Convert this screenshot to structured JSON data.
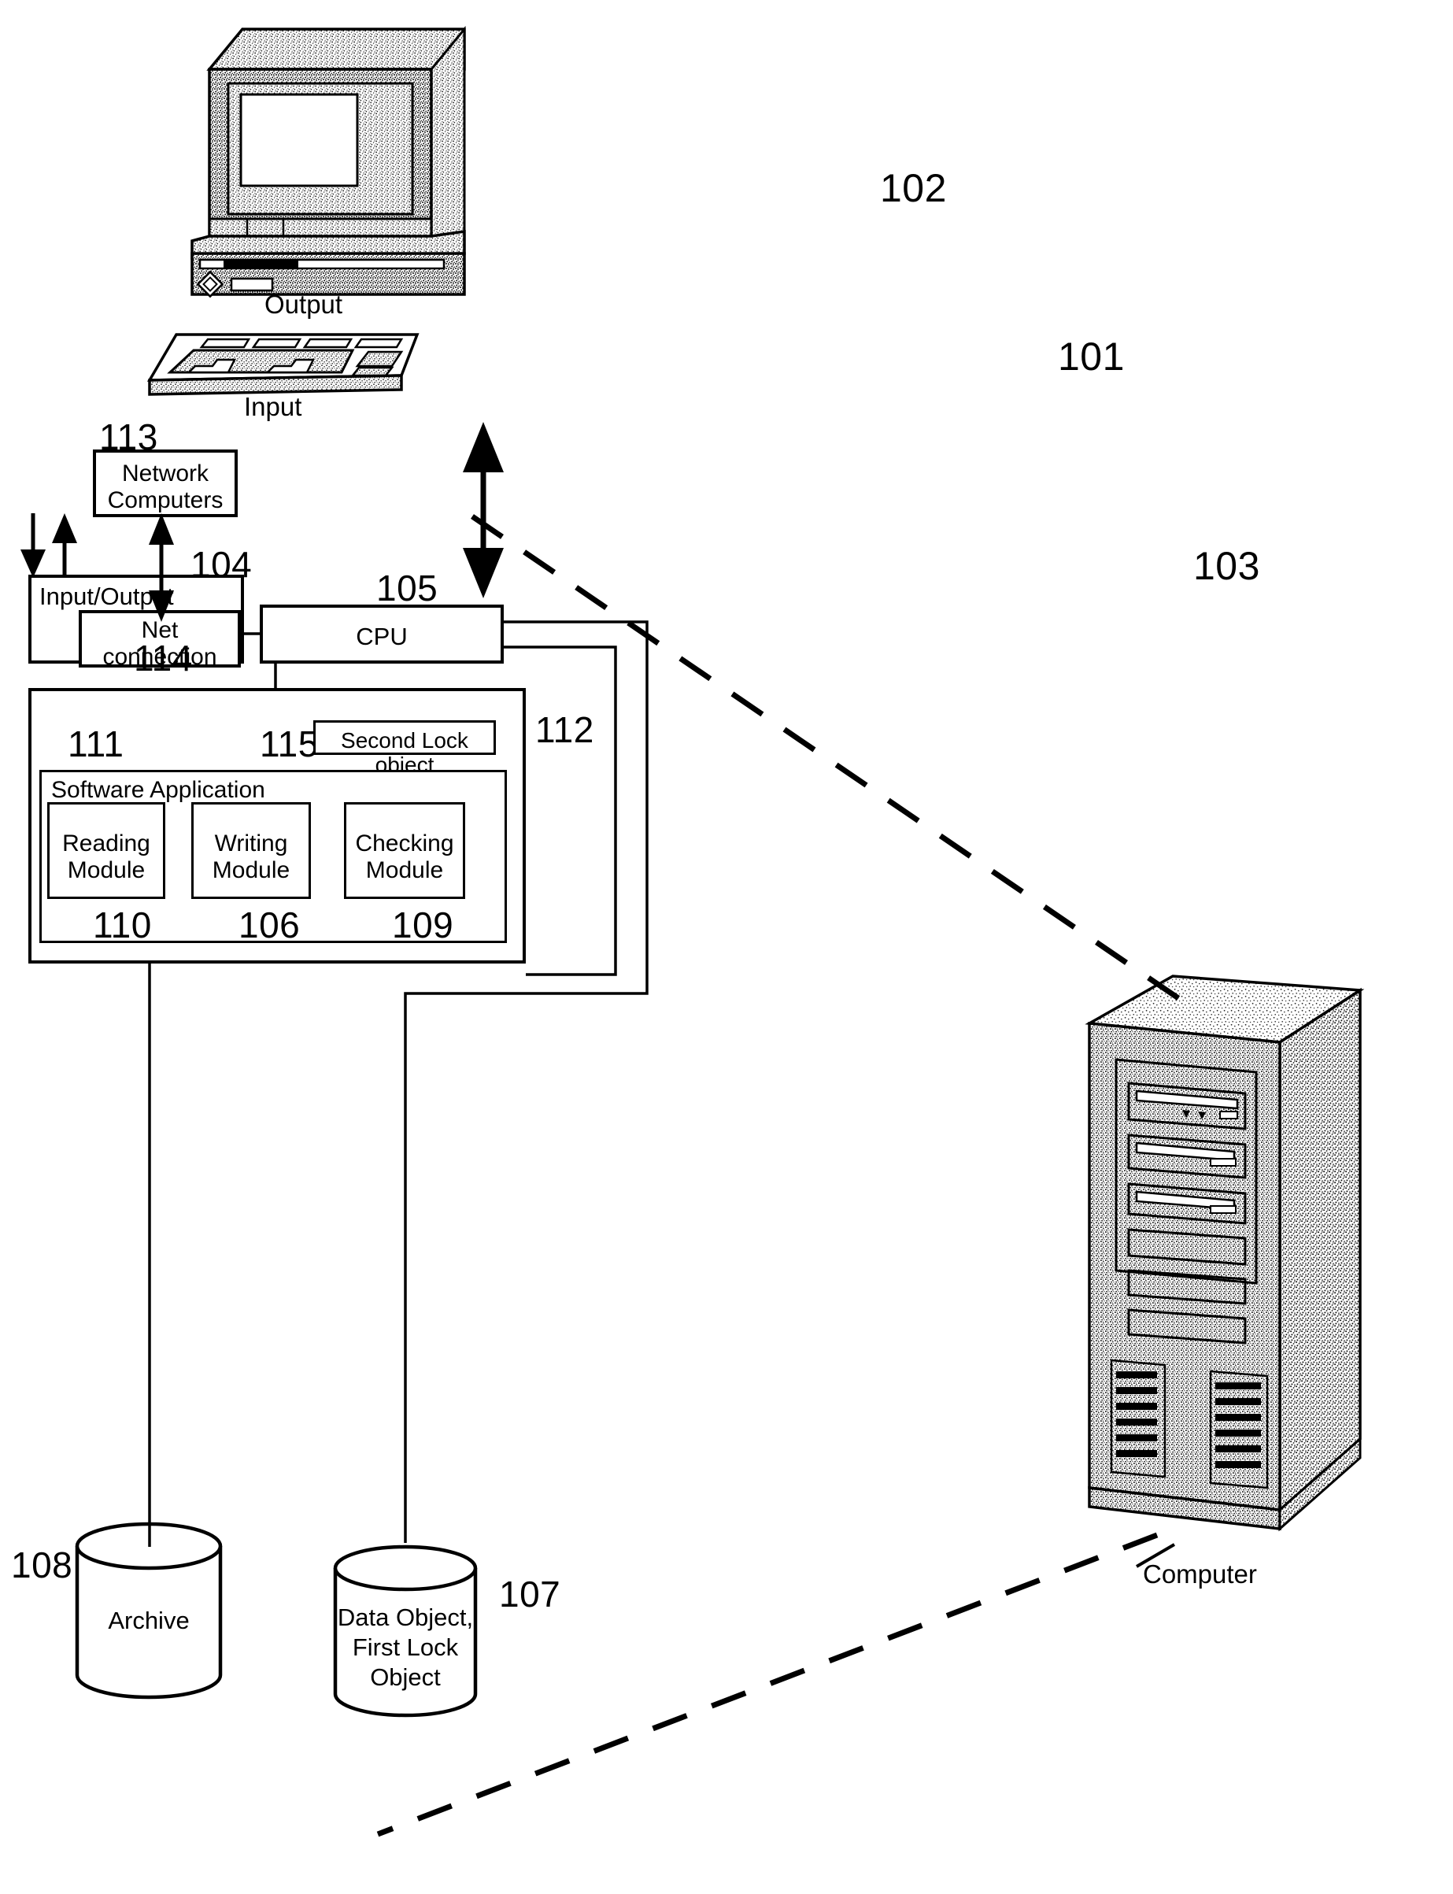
{
  "figure": {
    "kind": "patent-system-block-diagram",
    "line_color": "#000000",
    "background": "#ffffff"
  },
  "captions": {
    "output": "Output",
    "input": "Input",
    "computer": "Computer"
  },
  "reference_numerals": {
    "system": "101",
    "output_device": "102",
    "server_computer": "103",
    "io_unit": "104",
    "cpu": "105",
    "writing_module": "106",
    "data_object_store": "107",
    "archive_store": "108",
    "checking_module": "109",
    "reading_module": "110",
    "memory": "111",
    "bus": "112",
    "network_computers": "113",
    "net_connection": "114",
    "second_lock_object": "115"
  },
  "blocks": {
    "network_computers": {
      "line1": "Network",
      "line2": "Computers"
    },
    "io": {
      "label": "Input/Output"
    },
    "net_connection": {
      "label": "Net connection"
    },
    "cpu": {
      "label": "CPU"
    },
    "second_lock_object": {
      "label": "Second Lock object"
    },
    "software_application": {
      "label": "Software Application"
    },
    "reading_module": {
      "line1": "Reading",
      "line2": "Module"
    },
    "writing_module": {
      "line1": "Writing",
      "line2": "Module"
    },
    "checking_module": {
      "line1": "Checking",
      "line2": "Module"
    }
  },
  "stores": {
    "archive": {
      "label": "Archive"
    },
    "data_object": {
      "line1": "Data Object,",
      "line2": "First Lock",
      "line3": "Object"
    }
  }
}
